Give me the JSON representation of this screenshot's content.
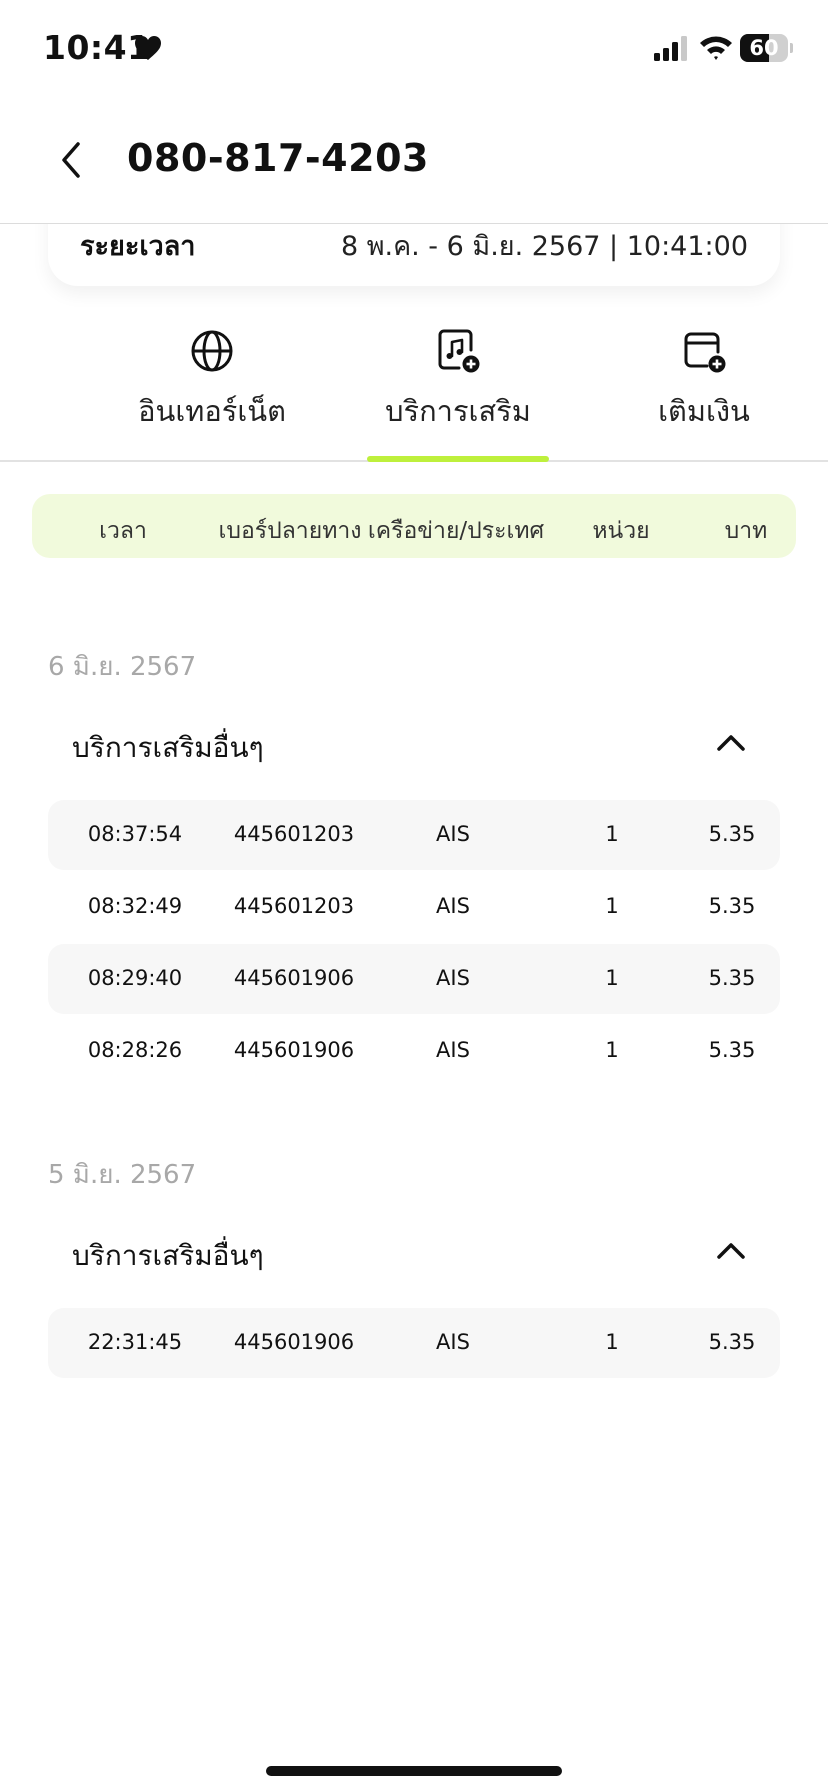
{
  "status_bar": {
    "time": "10:41",
    "battery_level": "60",
    "icons": [
      "heart-icon",
      "cellular-signal-icon",
      "wifi-icon",
      "battery-icon"
    ]
  },
  "header": {
    "title": "080-817-4203",
    "back_icon": "chevron-left-icon"
  },
  "period": {
    "label": "ระยะเวลา",
    "value": "8 พ.ค. - 6 มิ.ย. 2567 | 10:41:00"
  },
  "tabs": [
    {
      "label": "อินเทอร์เน็ต",
      "icon": "globe-icon",
      "active": false
    },
    {
      "label": "บริการเสริม",
      "icon": "music-add-icon",
      "active": true
    },
    {
      "label": "เติมเงิน",
      "icon": "wallet-add-icon",
      "active": false
    }
  ],
  "accent_color": "#bef03c",
  "columns": [
    "เวลา",
    "เบอร์ปลายทาง",
    "เครือข่าย/ประเทศ",
    "หน่วย",
    "บาท"
  ],
  "groups": [
    {
      "date": "6 มิ.ย. 2567",
      "title": "บริการเสริมอื่นๆ",
      "rows": [
        [
          "08:37:54",
          "445601203",
          "AIS",
          "1",
          "5.35"
        ],
        [
          "08:32:49",
          "445601203",
          "AIS",
          "1",
          "5.35"
        ],
        [
          "08:29:40",
          "445601906",
          "AIS",
          "1",
          "5.35"
        ],
        [
          "08:28:26",
          "445601906",
          "AIS",
          "1",
          "5.35"
        ]
      ]
    },
    {
      "date": "5 มิ.ย. 2567",
      "title": "บริการเสริมอื่นๆ",
      "rows": [
        [
          "22:31:45",
          "445601906",
          "AIS",
          "1",
          "5.35"
        ]
      ]
    }
  ]
}
